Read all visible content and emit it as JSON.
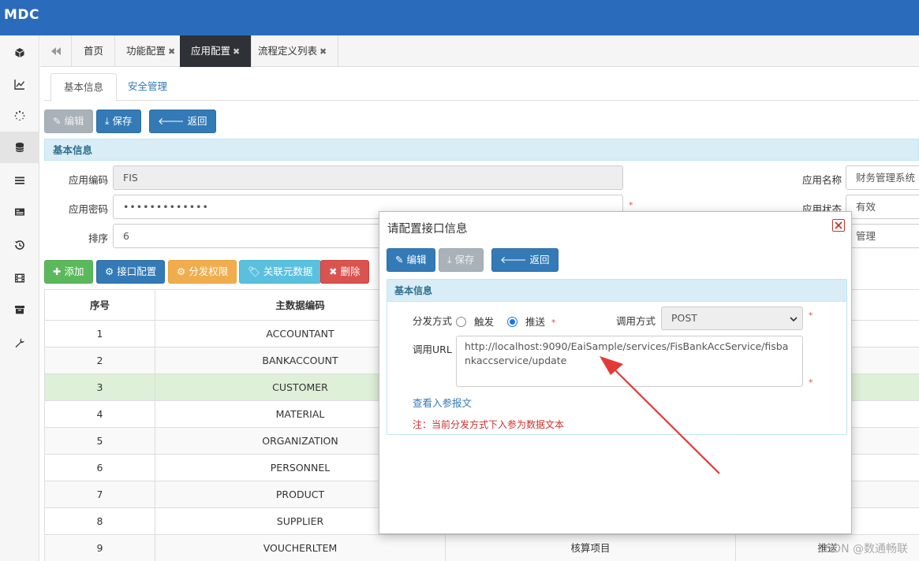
{
  "app": {
    "logo": "MDC"
  },
  "sidebar": {
    "items": [
      {
        "icon": "cube-icon"
      },
      {
        "icon": "chart-line-icon"
      },
      {
        "icon": "spinner-icon"
      },
      {
        "icon": "database-icon"
      },
      {
        "icon": "list-icon"
      },
      {
        "icon": "id-card-icon"
      },
      {
        "icon": "history-icon"
      },
      {
        "icon": "film-icon"
      },
      {
        "icon": "archive-icon"
      },
      {
        "icon": "wrench-icon"
      }
    ]
  },
  "tabs": [
    {
      "label": "首页",
      "closable": false
    },
    {
      "label": "功能配置",
      "closable": true
    },
    {
      "label": "应用配置",
      "closable": true,
      "active": true
    },
    {
      "label": "流程定义列表",
      "closable": true
    }
  ],
  "subtabs": [
    "基本信息",
    "安全管理"
  ],
  "toolbar": {
    "edit": "编辑",
    "save": "保存",
    "back": "返回"
  },
  "basic_panel": {
    "title": "基本信息"
  },
  "form": {
    "app_code_label": "应用编码",
    "app_code_value": "FIS",
    "app_pwd_label": "应用密码",
    "app_pwd_value": "•••••••••••••",
    "sort_label": "排序",
    "sort_value": "6",
    "app_name_label": "应用名称",
    "app_name_value": "财务管理系统",
    "app_status_label": "应用状态",
    "app_status_value": "有效",
    "third_value": "管理",
    "required_mark": "*"
  },
  "actions": {
    "add": "添加",
    "interface": "接口配置",
    "permission": "分发权限",
    "relate": "关联元数据",
    "delete": "删除"
  },
  "table": {
    "headers": [
      "序号",
      "主数据编码"
    ],
    "rows": [
      {
        "no": "1",
        "code": "ACCOUNTANT",
        "name": "",
        "extra": ""
      },
      {
        "no": "2",
        "code": "BANKACCOUNT",
        "name": "",
        "extra": ""
      },
      {
        "no": "3",
        "code": "CUSTOMER",
        "name": "",
        "extra": ""
      },
      {
        "no": "4",
        "code": "MATERIAL",
        "name": "",
        "extra": ""
      },
      {
        "no": "5",
        "code": "ORGANIZATION",
        "name": "",
        "extra": ""
      },
      {
        "no": "6",
        "code": "PERSONNEL",
        "name": "",
        "extra": ""
      },
      {
        "no": "7",
        "code": "PRODUCT",
        "name": "",
        "extra": ""
      },
      {
        "no": "8",
        "code": "SUPPLIER",
        "name": "",
        "extra": ""
      },
      {
        "no": "9",
        "code": "VOUCHERLTEM",
        "name": "核算项目",
        "extra": "推送"
      }
    ]
  },
  "modal": {
    "title": "请配置接口信息",
    "edit": "编辑",
    "save": "保存",
    "back": "返回",
    "panel_title": "基本信息",
    "dist_label": "分发方式",
    "opt_trigger": "触发",
    "opt_push": "推送",
    "call_label": "调用方式",
    "call_value": "POST",
    "url_label": "调用URL",
    "url_value": "http://localhost:9090/EaiSample/services/FisBankAccService/fisbankaccservice/update",
    "view_link": "查看入参报文",
    "note": "注：当前分发方式下入参为数据文本",
    "required_mark": "*"
  },
  "watermark": "CSDN @数通畅联",
  "colors": {
    "topbar": "#2a6cbb",
    "primary": "#337ab7",
    "arrow": "#e53935"
  }
}
